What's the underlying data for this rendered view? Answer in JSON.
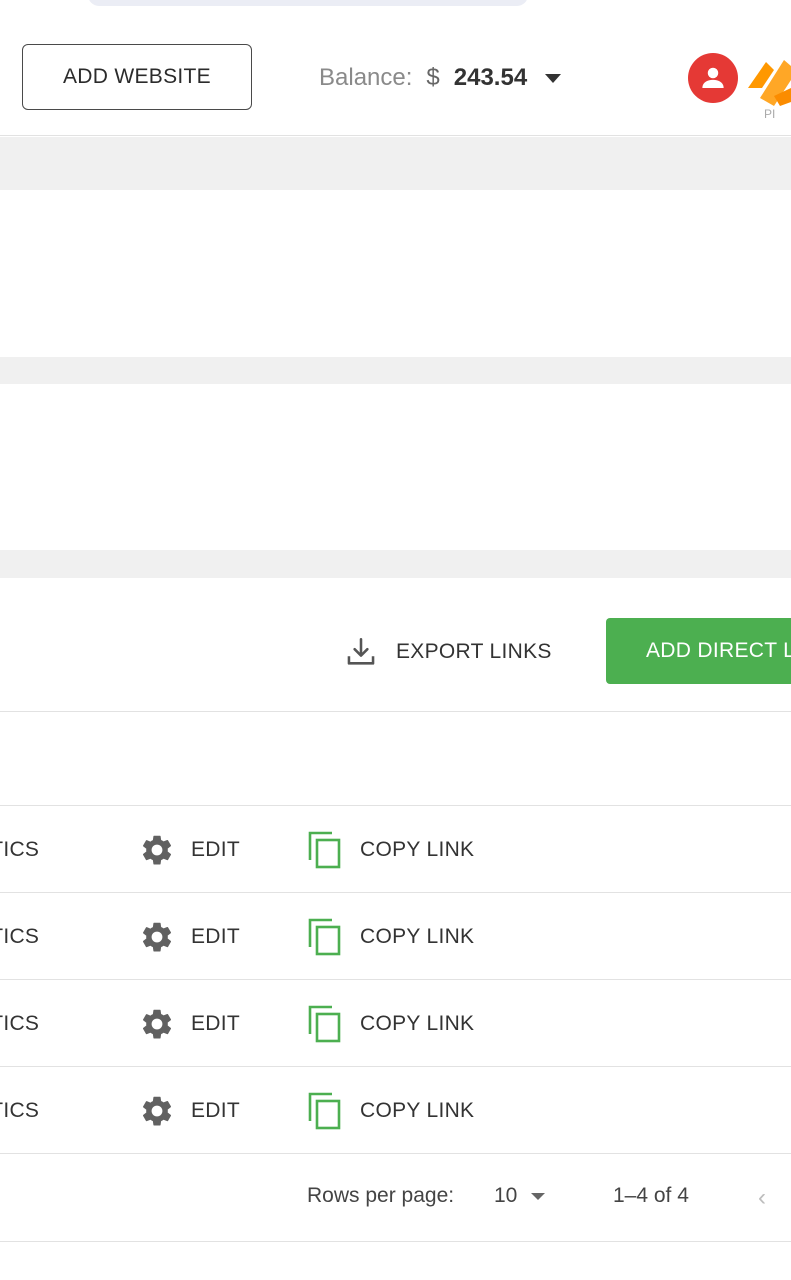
{
  "header": {
    "add_website_label": "ADD WEBSITE",
    "balance_label": "Balance:",
    "balance_currency": "$",
    "balance_amount": "243.54"
  },
  "toolbar": {
    "export_label": "EXPORT LINKS",
    "add_direct_label": "ADD DIRECT L"
  },
  "rows": [
    {
      "stats": "STATISTICS",
      "edit": "EDIT",
      "copy": "COPY LINK"
    },
    {
      "stats": "STATISTICS",
      "edit": "EDIT",
      "copy": "COPY LINK"
    },
    {
      "stats": "STATISTICS",
      "edit": "EDIT",
      "copy": "COPY LINK"
    },
    {
      "stats": "STATISTICS",
      "edit": "EDIT",
      "copy": "COPY LINK"
    }
  ],
  "pagination": {
    "rows_per_page_label": "Rows per page:",
    "rows_per_page_value": "10",
    "range_text": "1–4 of 4",
    "prev_glyph": "‹"
  },
  "colors": {
    "accent_green": "#4caf50",
    "avatar_red": "#e53935",
    "brand_orange": "#ff9800"
  },
  "icons": [
    "user-icon",
    "download-icon",
    "gear-icon",
    "copy-icon",
    "chevron-left-icon"
  ]
}
